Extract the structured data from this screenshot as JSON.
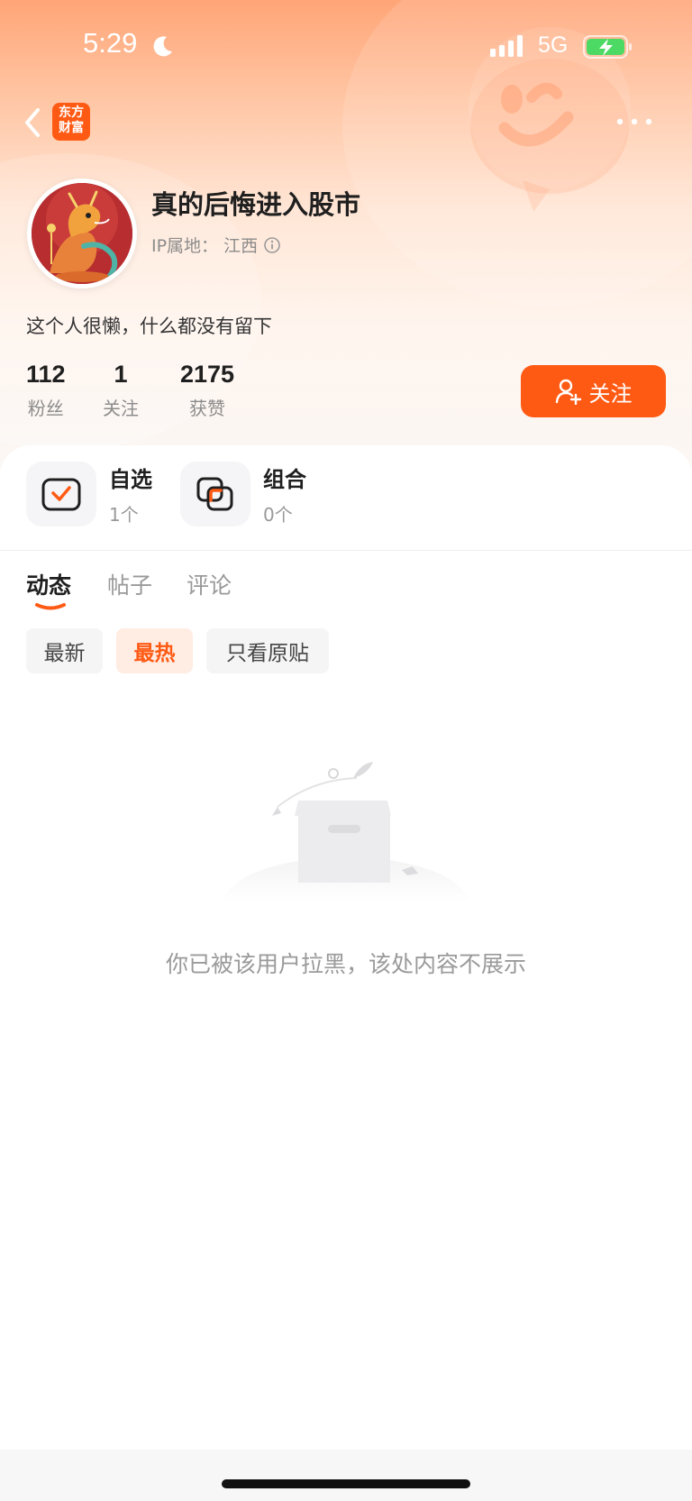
{
  "status_bar": {
    "time": "5:29",
    "network": "5G",
    "icons": [
      "moon-icon",
      "signal-icon",
      "battery-charging-icon"
    ]
  },
  "nav": {
    "logo_line1": "东方",
    "logo_line2": "财富",
    "icons": [
      "back-chevron-icon",
      "more-dots-icon"
    ]
  },
  "profile": {
    "username": "真的后悔进入股市",
    "ip_label": "IP属地：",
    "ip_location": "江西",
    "bio": "这个人很懒，什么都没有留下",
    "avatar_icon": "dragon-avatar"
  },
  "stats": [
    {
      "value": "112",
      "label": "粉丝"
    },
    {
      "value": "1",
      "label": "关注"
    },
    {
      "value": "2175",
      "label": "获赞"
    }
  ],
  "follow_button": {
    "label": "关注",
    "icon": "add-user-icon"
  },
  "portfolio_tiles": [
    {
      "title": "自选",
      "count": "1个",
      "icon": "watchlist-check-icon"
    },
    {
      "title": "组合",
      "count": "0个",
      "icon": "portfolio-overlap-icon"
    }
  ],
  "tabs": [
    {
      "label": "动态",
      "active": true
    },
    {
      "label": "帖子",
      "active": false
    },
    {
      "label": "评论",
      "active": false
    }
  ],
  "filters": [
    {
      "label": "最新",
      "active": false
    },
    {
      "label": "最热",
      "active": true
    },
    {
      "label": "只看原贴",
      "active": false
    }
  ],
  "empty_state": {
    "message": "你已被该用户拉黑，该处内容不展示",
    "icon": "empty-box-illustration"
  },
  "colors": {
    "accent": "#ff5a14",
    "header_top": "#ffa577",
    "muted_text": "#999999"
  }
}
